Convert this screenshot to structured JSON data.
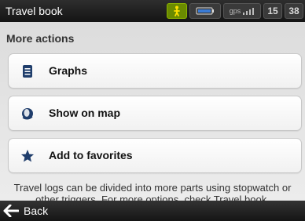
{
  "header": {
    "title": "Travel book",
    "status": {
      "person_icon": "walking-person-icon",
      "battery_icon": "battery-icon",
      "gps_label": "gps",
      "signal_icon": "signal-bars-icon",
      "hour": "15",
      "minute": "38"
    }
  },
  "section_title": "More actions",
  "actions": [
    {
      "label": "Graphs",
      "icon": "document-icon"
    },
    {
      "label": "Show on map",
      "icon": "globe-icon"
    },
    {
      "label": "Add to favorites",
      "icon": "star-icon"
    }
  ],
  "note": "Travel logs can be divided into more parts using stopwatch or other triggers. For more options, check Travel book.",
  "footer": {
    "back_label": "Back",
    "back_icon": "arrow-left-icon"
  },
  "colors": {
    "title_bar": "#1e1e1e",
    "content_bg": "#e6e6e6",
    "card_bg": "#ffffff",
    "icon_blue": "#1f3d6b",
    "person_green": "#8bb300"
  }
}
